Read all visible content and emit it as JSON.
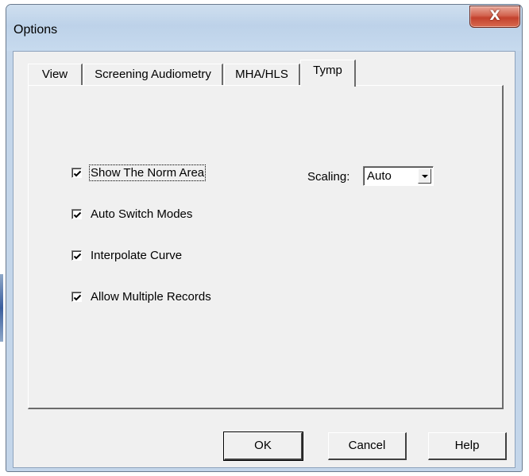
{
  "window": {
    "title": "Options",
    "close_glyph": "X"
  },
  "tabs": [
    {
      "label": "View",
      "active": false
    },
    {
      "label": "Screening Audiometry",
      "active": false
    },
    {
      "label": "MHA/HLS",
      "active": false
    },
    {
      "label": "Tymp",
      "active": true
    }
  ],
  "options": [
    {
      "label": "Show The Norm Area",
      "checked": true
    },
    {
      "label": "Auto Switch Modes",
      "checked": true
    },
    {
      "label": "Interpolate Curve",
      "checked": true
    },
    {
      "label": "Allow Multiple Records",
      "checked": true
    }
  ],
  "scaling": {
    "label": "Scaling:",
    "value": "Auto"
  },
  "buttons": {
    "ok": "OK",
    "cancel": "Cancel",
    "help": "Help"
  },
  "colors": {
    "frame": "#c4d6ea",
    "face": "#f0f0f0",
    "close": "#c3412d"
  }
}
